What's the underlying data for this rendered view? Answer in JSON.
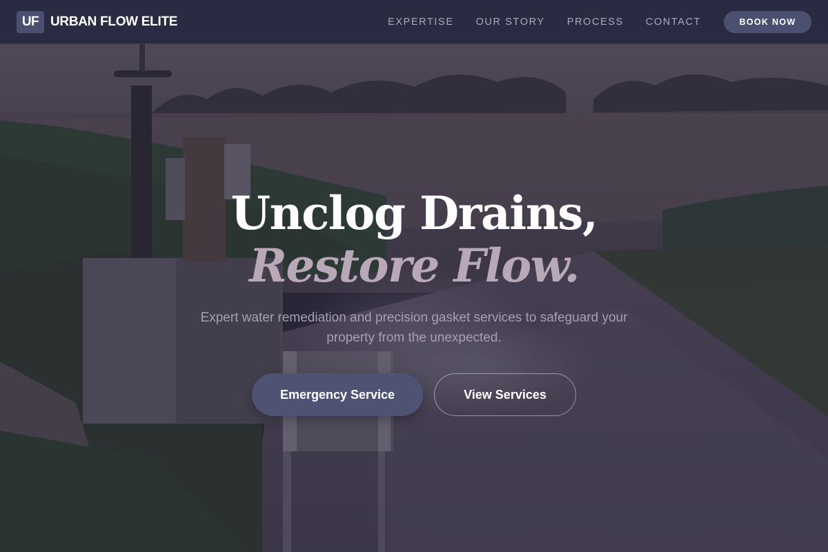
{
  "navbar": {
    "logo_mark": "UF",
    "brand_name": "URBAN FLOW ELITE",
    "links": [
      {
        "label": "EXPERTISE"
      },
      {
        "label": "OUR STORY"
      },
      {
        "label": "PROCESS"
      },
      {
        "label": "CONTACT"
      }
    ],
    "book_button": "BOOK NOW"
  },
  "hero": {
    "headline_line1": "Unclog Drains,",
    "headline_line2": "Restore Flow.",
    "subtitle": "Expert water remediation and precision gasket services to safeguard your property from the unexpected.",
    "primary_button": "Emergency Service",
    "secondary_button": "View Services"
  },
  "colors": {
    "navbar_bg": "#2b2a43",
    "accent": "#4c5070",
    "headline_accent": "#b9a9b8",
    "overlay": "#262134"
  }
}
